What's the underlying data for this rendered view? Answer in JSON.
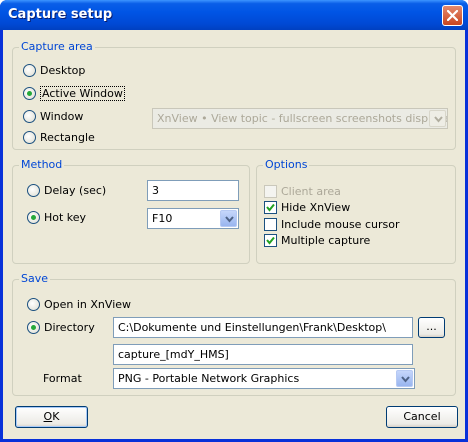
{
  "window": {
    "title": "Capture setup"
  },
  "capture_area": {
    "label": "Capture area",
    "options": [
      "Desktop",
      "Active Window",
      "Window",
      "Rectangle"
    ],
    "selected": "Active Window",
    "window_select": "XnView • View topic - fullscreen screenshots displayed no"
  },
  "method": {
    "label": "Method",
    "delay_label": "Delay (sec)",
    "delay_value": "3",
    "hotkey_label": "Hot key",
    "hotkey_value": "F10",
    "selected": "Hot key"
  },
  "options": {
    "label": "Options",
    "items": [
      {
        "label": "Client area",
        "checked": false,
        "disabled": true
      },
      {
        "label": "Hide XnView",
        "checked": true,
        "disabled": false
      },
      {
        "label": "Include mouse cursor",
        "checked": false,
        "disabled": false
      },
      {
        "label": "Multiple capture",
        "checked": true,
        "disabled": false
      }
    ]
  },
  "save": {
    "label": "Save",
    "open_label": "Open in XnView",
    "directory_label": "Directory",
    "directory_value": "C:\\Dokumente und Einstellungen\\Frank\\Desktop\\",
    "browse_label": "...",
    "filename_value": "capture_[mdY_HMS]",
    "format_label": "Format",
    "format_value": "PNG - Portable Network Graphics",
    "selected": "Directory"
  },
  "buttons": {
    "ok_prefix": "O",
    "ok_rest": "K",
    "cancel": "Cancel"
  },
  "colors": {
    "title_bar": "#0055e5",
    "group_label": "#0046d5",
    "radio_dot": "#24a83a",
    "dialog_bg": "#ece9d8"
  }
}
